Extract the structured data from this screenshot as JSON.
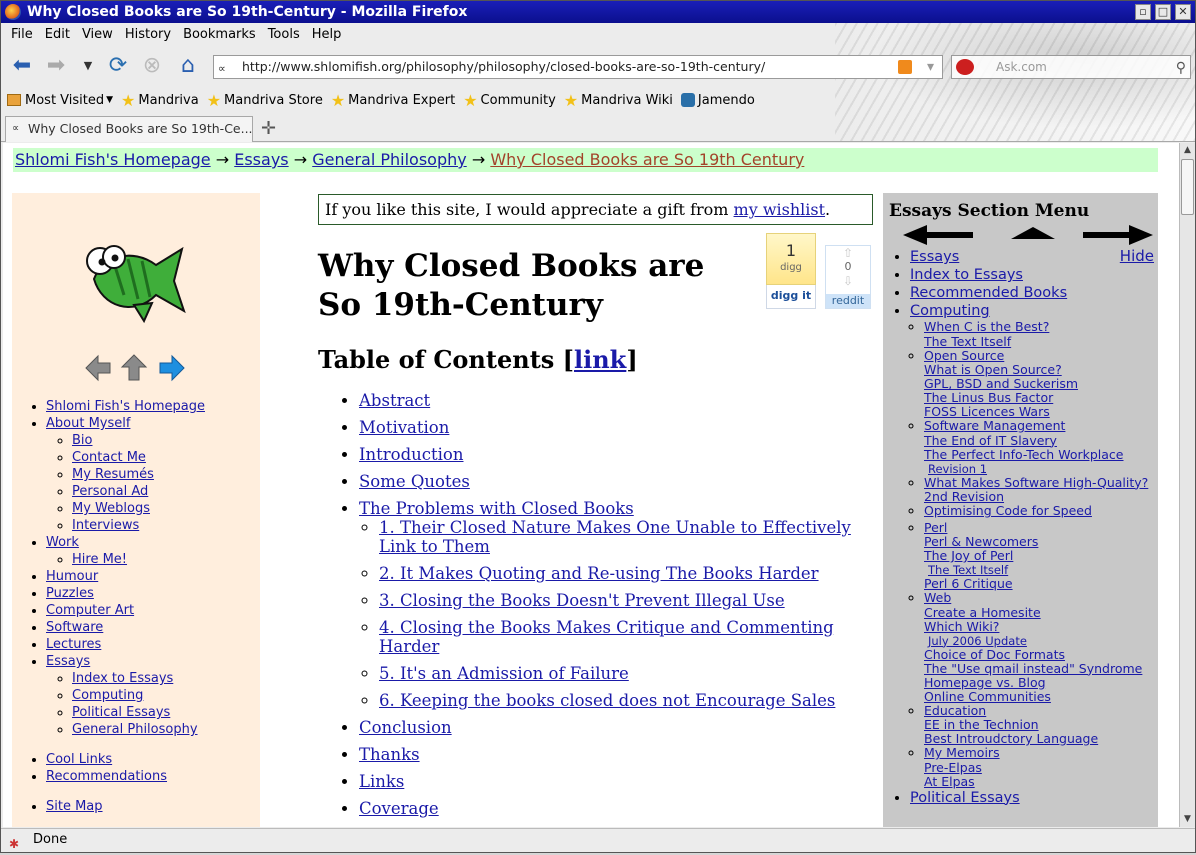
{
  "window": {
    "title": "Why Closed Books are So 19th-Century - Mozilla Firefox"
  },
  "menu": [
    "File",
    "Edit",
    "View",
    "History",
    "Bookmarks",
    "Tools",
    "Help"
  ],
  "url": "http://www.shlomifish.org/philosophy/philosophy/closed-books-are-so-19th-century/",
  "search": {
    "placeholder": "Ask.com"
  },
  "bookmarks": [
    "Most Visited",
    "Mandriva",
    "Mandriva Store",
    "Mandriva Expert",
    "Community",
    "Mandriva Wiki",
    "Jamendo"
  ],
  "tab": {
    "label": "Why Closed Books are So 19th-Ce..."
  },
  "status": "Done",
  "breadcrumbs": {
    "home": "Shlomi Fish's Homepage",
    "essays": "Essays",
    "philosophy": "General Philosophy",
    "current": "Why Closed Books are So 19th Century",
    "sep": "→"
  },
  "leftnav": {
    "top": [
      {
        "label": "Shlomi Fish's Homepage"
      },
      {
        "label": "About Myself",
        "children": [
          "Bio",
          "Contact Me",
          "My Resumés",
          "Personal Ad",
          "My Weblogs",
          "Interviews"
        ]
      },
      {
        "label": "Work",
        "children": [
          "Hire Me!"
        ]
      },
      {
        "label": "Humour"
      },
      {
        "label": "Puzzles"
      },
      {
        "label": "Computer Art"
      },
      {
        "label": "Software"
      },
      {
        "label": "Lectures"
      },
      {
        "label": "Essays",
        "children": [
          "Index to Essays",
          "Computing",
          "Political Essays",
          "General Philosophy"
        ]
      }
    ],
    "bottom1": [
      "Cool Links",
      "Recommendations"
    ],
    "bottom2": [
      "Site Map"
    ]
  },
  "gift": {
    "text": "If you like this site, I would appreciate a gift from ",
    "link": "my wishlist",
    "end": "."
  },
  "heading": "Why Closed Books are So 19th-Century",
  "digg": {
    "count": "1",
    "label": "digg",
    "button": "digg it"
  },
  "reddit": {
    "score": "0",
    "label": "reddit"
  },
  "toc": {
    "title": "Table of Contents [",
    "title_link": "link",
    "title_end": "]",
    "items": [
      {
        "label": "Abstract"
      },
      {
        "label": "Motivation"
      },
      {
        "label": "Introduction"
      },
      {
        "label": "Some Quotes"
      },
      {
        "label": "The Problems with Closed Books",
        "children": [
          "1. Their Closed Nature Makes One Unable to Effectively Link to Them",
          "2. It Makes Quoting and Re-using The Books Harder",
          "3. Closing the Books Doesn't Prevent Illegal Use",
          "4. Closing the Books Makes Critique and Commenting Harder",
          "5. It's an Admission of Failure",
          "6. Keeping the books closed does not Encourage Sales"
        ]
      },
      {
        "label": "Conclusion"
      },
      {
        "label": "Thanks"
      },
      {
        "label": "Links"
      },
      {
        "label": "Coverage"
      }
    ]
  },
  "essays_menu": {
    "title": "Essays Section Menu",
    "hide": "Hide",
    "items": [
      {
        "label": "Essays"
      },
      {
        "label": "Index to Essays"
      },
      {
        "label": "Recommended Books"
      },
      {
        "label": "Computing",
        "children": [
          {
            "label": "When C is the Best?",
            "children": [
              "The Text Itself"
            ]
          },
          {
            "label": "Open Source",
            "children": [
              "What is Open Source?",
              "GPL, BSD and Suckerism",
              "The Linus Bus Factor",
              "FOSS Licences Wars"
            ]
          },
          {
            "label": "Software Management",
            "children": [
              "The End of IT Slavery",
              "The Perfect Info-Tech Workplace",
              "Revision 1"
            ]
          },
          {
            "label": "What Makes Software High-Quality?",
            "children": [
              "2nd Revision"
            ]
          },
          {
            "label": "Optimising Code for Speed"
          },
          {
            "label": "Perl",
            "children": [
              "Perl & Newcomers",
              "The Joy of Perl",
              "The Text Itself",
              "Perl 6 Critique"
            ]
          },
          {
            "label": "Web",
            "children": [
              "Create a Homesite",
              "Which Wiki?",
              "July 2006 Update",
              "Choice of Doc Formats",
              "The \"Use qmail instead\" Syndrome",
              "Homepage vs. Blog",
              "Online Communities"
            ]
          },
          {
            "label": "Education",
            "children": [
              "EE in the Technion",
              "Best Introudctory Language"
            ]
          },
          {
            "label": "My Memoirs",
            "children": [
              "Pre-Elpas",
              "At Elpas"
            ]
          }
        ]
      },
      {
        "label": "Political Essays"
      }
    ]
  }
}
